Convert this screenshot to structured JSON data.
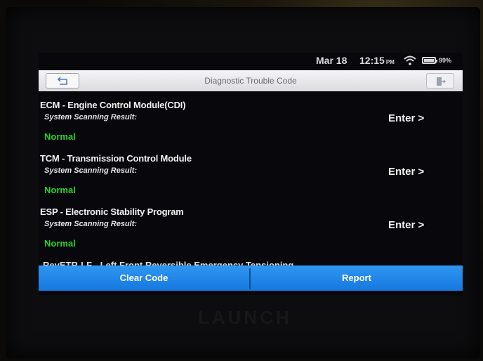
{
  "status_bar": {
    "date": "Mar 18",
    "time": "12:15",
    "ampm": "PM",
    "battery": "99%",
    "wifi_icon": "wifi-icon",
    "battery_icon": "battery-icon"
  },
  "title_bar": {
    "title": "Diagnostic Trouble Code",
    "back_icon": "back-arrow-icon",
    "exit_icon": "exit-icon"
  },
  "modules": [
    {
      "title": "ECM - Engine Control Module(CDI)",
      "subtitle": "System Scanning Result:",
      "status": "Normal",
      "action": "Enter >"
    },
    {
      "title": "TCM - Transmission Control Module",
      "subtitle": "System Scanning Result:",
      "status": "Normal",
      "action": "Enter >"
    },
    {
      "title": "ESP - Electronic Stability Program",
      "subtitle": "System Scanning Result:",
      "status": "Normal",
      "action": "Enter >"
    }
  ],
  "partial_item": "RevETR-LF - Left Front Reversible Emergency Tensioning",
  "buttons": {
    "clear": "Clear Code",
    "report": "Report"
  },
  "brand": "LAUNCH",
  "colors": {
    "status_ok": "#2bd12b",
    "button_blue": "#1e88e5"
  }
}
